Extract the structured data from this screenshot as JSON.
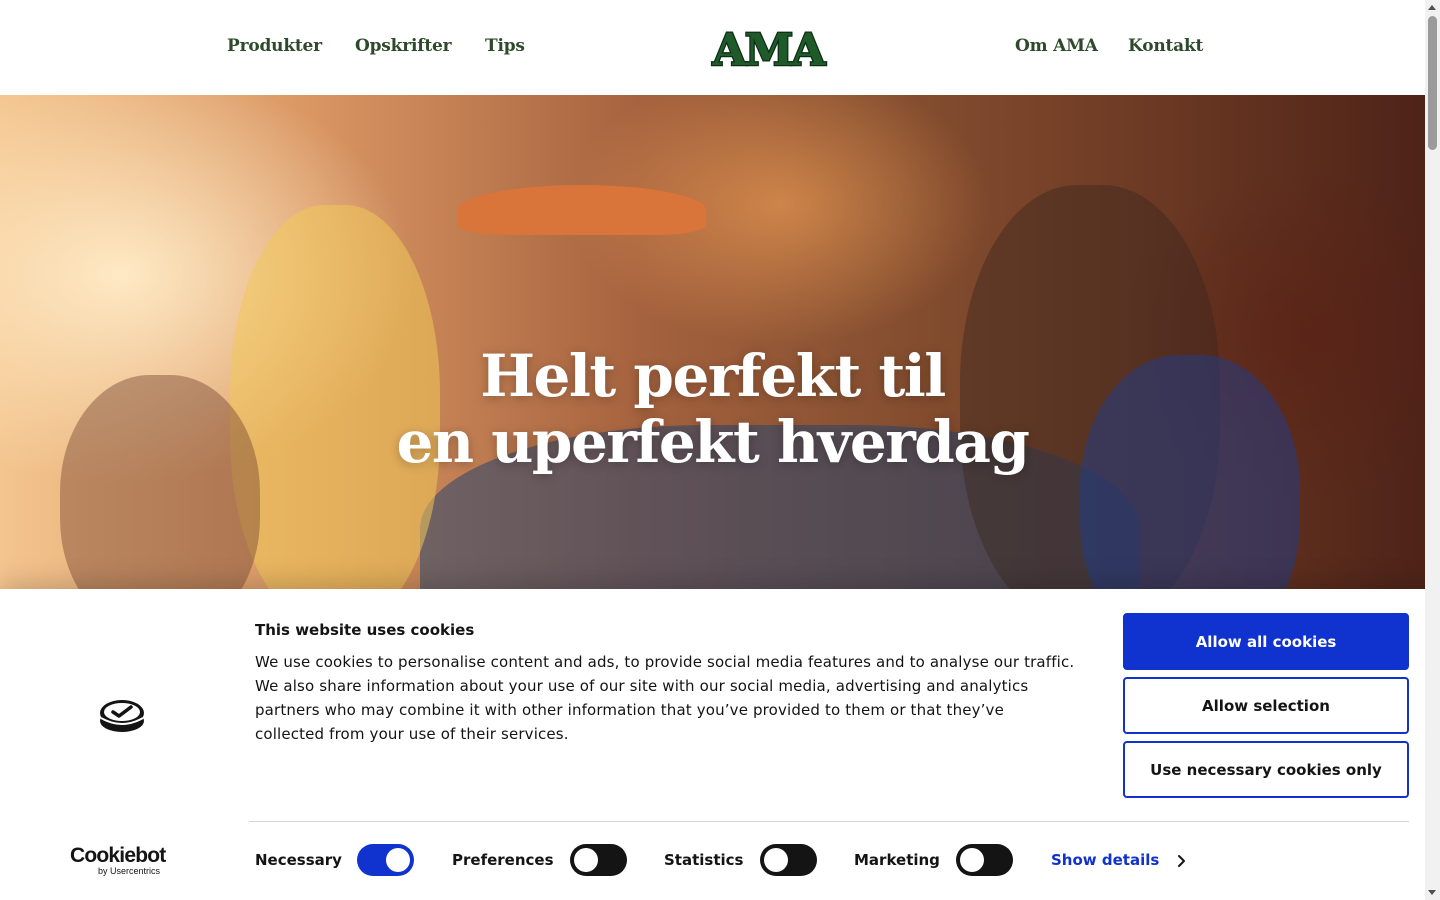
{
  "header": {
    "nav_left": [
      "Produkter",
      "Opskrifter",
      "Tips"
    ],
    "logo_text": "AMA",
    "nav_right": [
      "Om AMA",
      "Kontakt"
    ]
  },
  "hero": {
    "headline_line1": "Helt perfekt til",
    "headline_line2": "en uperfekt hverdag"
  },
  "cookie_banner": {
    "title": "This website uses cookies",
    "body": "We use cookies to personalise content and ads, to provide social media features and to analyse our traffic. We also share information about your use of our site with our social media, advertising and analytics partners who may combine it with other information that you’ve provided to them or that they’ve collected from your use of their services.",
    "buttons": {
      "allow_all": "Allow all cookies",
      "allow_selection": "Allow selection",
      "necessary_only": "Use necessary cookies only"
    },
    "categories": [
      {
        "label": "Necessary",
        "enabled": true
      },
      {
        "label": "Preferences",
        "enabled": false
      },
      {
        "label": "Statistics",
        "enabled": false
      },
      {
        "label": "Marketing",
        "enabled": false
      }
    ],
    "show_details": "Show details",
    "brand_name": "Cookiebot",
    "brand_sub": "by Usercentrics"
  },
  "colors": {
    "brand_green": "#2d4a2a",
    "logo_green": "#1e5a2a",
    "button_blue": "#1032cf",
    "toggle_off": "#141414"
  },
  "icons": [
    "cookie-consent-icon",
    "chevron-right-icon"
  ]
}
